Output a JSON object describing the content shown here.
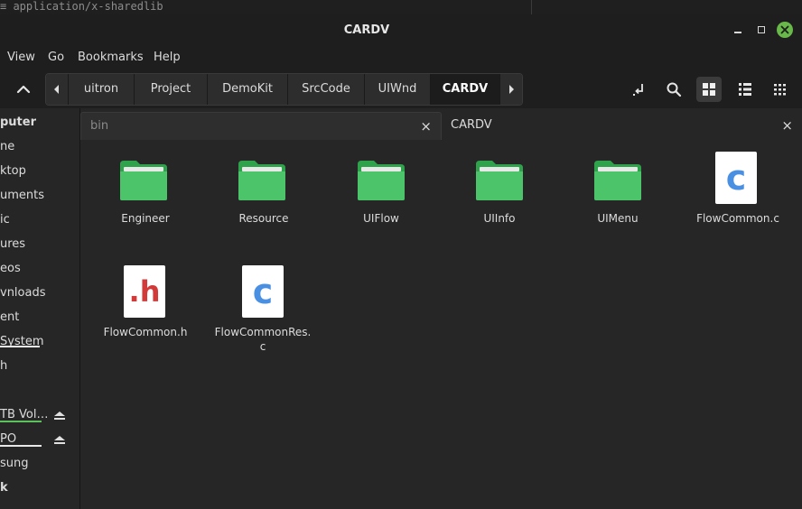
{
  "top_strip": {
    "text": "≡ application/x-sharedlib"
  },
  "window": {
    "title": "CARDV"
  },
  "menubar": {
    "items": [
      "View",
      "Go",
      "Bookmarks",
      "Help"
    ]
  },
  "breadcrumbs": [
    "uitron",
    "Project",
    "DemoKit",
    "SrcCode",
    "UIWnd",
    "CARDV"
  ],
  "sidebar": {
    "items": [
      {
        "label": "puter"
      },
      {
        "label": "ne"
      },
      {
        "label": "ktop"
      },
      {
        "label": "uments"
      },
      {
        "label": "ic"
      },
      {
        "label": "ures"
      },
      {
        "label": "eos"
      },
      {
        "label": "vnloads"
      },
      {
        "label": "ent"
      },
      {
        "label": "System"
      },
      {
        "label": "h"
      },
      {
        "label": "TB Vol…"
      },
      {
        "label": "PO"
      },
      {
        "label": "sung"
      },
      {
        "label": "k"
      }
    ]
  },
  "tabs": [
    {
      "label": "bin",
      "close": "×"
    },
    {
      "label": "CARDV",
      "close": "×"
    }
  ],
  "files": [
    {
      "name": "Engineer",
      "kind": "folder"
    },
    {
      "name": "Resource",
      "kind": "folder"
    },
    {
      "name": "UIFlow",
      "kind": "folder"
    },
    {
      "name": "UIInfo",
      "kind": "folder"
    },
    {
      "name": "UIMenu",
      "kind": "folder"
    },
    {
      "name": "FlowCommon.c",
      "kind": "c-source",
      "glyph": "c"
    },
    {
      "name": "FlowCommon.h",
      "kind": "c-header",
      "glyph": ".h"
    },
    {
      "name": "FlowCommonRes.",
      "name2": "c",
      "kind": "c-source",
      "glyph": "c"
    }
  ],
  "colors": {
    "folder": "#4cc46a",
    "folder_dark": "#2ea34b",
    "c_glyph": "#4a90e2",
    "h_glyph": "#d23a3a",
    "accent_green": "#68b84a"
  }
}
